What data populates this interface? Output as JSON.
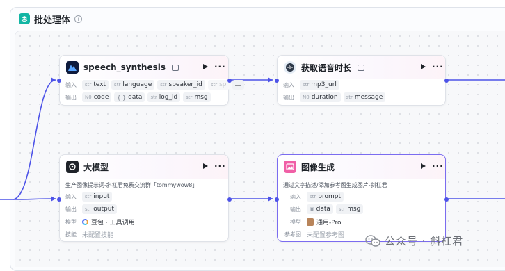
{
  "batch": {
    "title": "批处理体"
  },
  "labels": {
    "input": "输入",
    "output": "输出",
    "model": "模型",
    "skill": "技能",
    "ref": "参考图"
  },
  "nodes": {
    "speech": {
      "title": "speech_synthesis",
      "inputs": [
        {
          "type": "str",
          "name": "text"
        },
        {
          "type": "str",
          "name": "language"
        },
        {
          "type": "str",
          "name": "speaker_id"
        },
        {
          "type": "str",
          "name": "sp"
        },
        {
          "type": "",
          "name": "…"
        }
      ],
      "outputs": [
        {
          "type": "N0",
          "name": "code"
        },
        {
          "type": "{ }",
          "name": "data"
        },
        {
          "type": "str",
          "name": "log_id"
        },
        {
          "type": "str",
          "name": "msg"
        }
      ]
    },
    "duration": {
      "title": "获取语音时长",
      "inputs": [
        {
          "type": "str",
          "name": "mp3_url"
        }
      ],
      "outputs": [
        {
          "type": "N0",
          "name": "duration"
        },
        {
          "type": "str",
          "name": "message"
        }
      ]
    },
    "llm": {
      "title": "大模型",
      "description": "生产图像提示词-斜杠君免费交流群「tommywow8」",
      "inputs": [
        {
          "type": "str",
          "name": "input"
        }
      ],
      "outputs": [
        {
          "type": "str",
          "name": "output"
        }
      ],
      "model": "豆包 · 工具调用",
      "skill": "未配置技能"
    },
    "image": {
      "title": "图像生成",
      "description": "通过文字描述/添加参考图生成图片-斜杠君",
      "inputs": [
        {
          "type": "str",
          "name": "prompt"
        }
      ],
      "outputs": [
        {
          "type": "img",
          "name": "data"
        },
        {
          "type": "str",
          "name": "msg"
        }
      ],
      "model": "通用-Pro",
      "ref": "未配置参考图"
    }
  },
  "watermark": {
    "text": "公众号 · 斜杠君"
  },
  "colors": {
    "wire": "#4d53e8",
    "selected": "#7b6cf0",
    "batch_icon": "#12b5a4"
  }
}
